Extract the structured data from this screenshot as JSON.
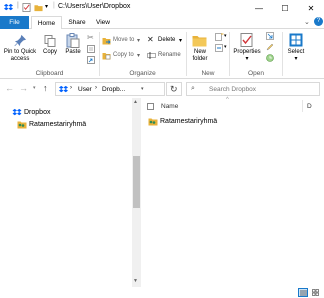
{
  "window": {
    "path": "C:\\Users\\User\\Dropbox",
    "minimize": "—",
    "maximize": "☐",
    "close": "✕",
    "help": "?"
  },
  "tabs": {
    "file": "File",
    "home": "Home",
    "share": "Share",
    "view": "View"
  },
  "ribbon": {
    "clipboard": {
      "pin_label": "Pin to Quick access",
      "copy_label": "Copy",
      "paste_label": "Paste",
      "group": "Clipboard"
    },
    "organize": {
      "move_to": "Move to",
      "copy_to": "Copy to",
      "delete": "Delete",
      "rename": "Rename",
      "group": "Organize"
    },
    "new": {
      "new_folder": "New folder",
      "group": "New"
    },
    "open": {
      "properties": "Properties",
      "group": "Open"
    },
    "select": {
      "select": "Select"
    }
  },
  "address": {
    "crumbs": [
      "User",
      "Dropb..."
    ],
    "search_placeholder": "Search Dropbox"
  },
  "navpane": {
    "items": [
      {
        "label": "Dropbox"
      },
      {
        "label": "Ratamestariryhmä"
      }
    ]
  },
  "content": {
    "columns": {
      "name": "Name",
      "date": "D"
    },
    "rows": [
      {
        "name": "Ratamestariryhmä"
      }
    ]
  },
  "colors": {
    "accent": "#1979ca",
    "dropbox": "#0061fe",
    "folder": "#e8b23a",
    "select_blue": "#1979ca"
  }
}
